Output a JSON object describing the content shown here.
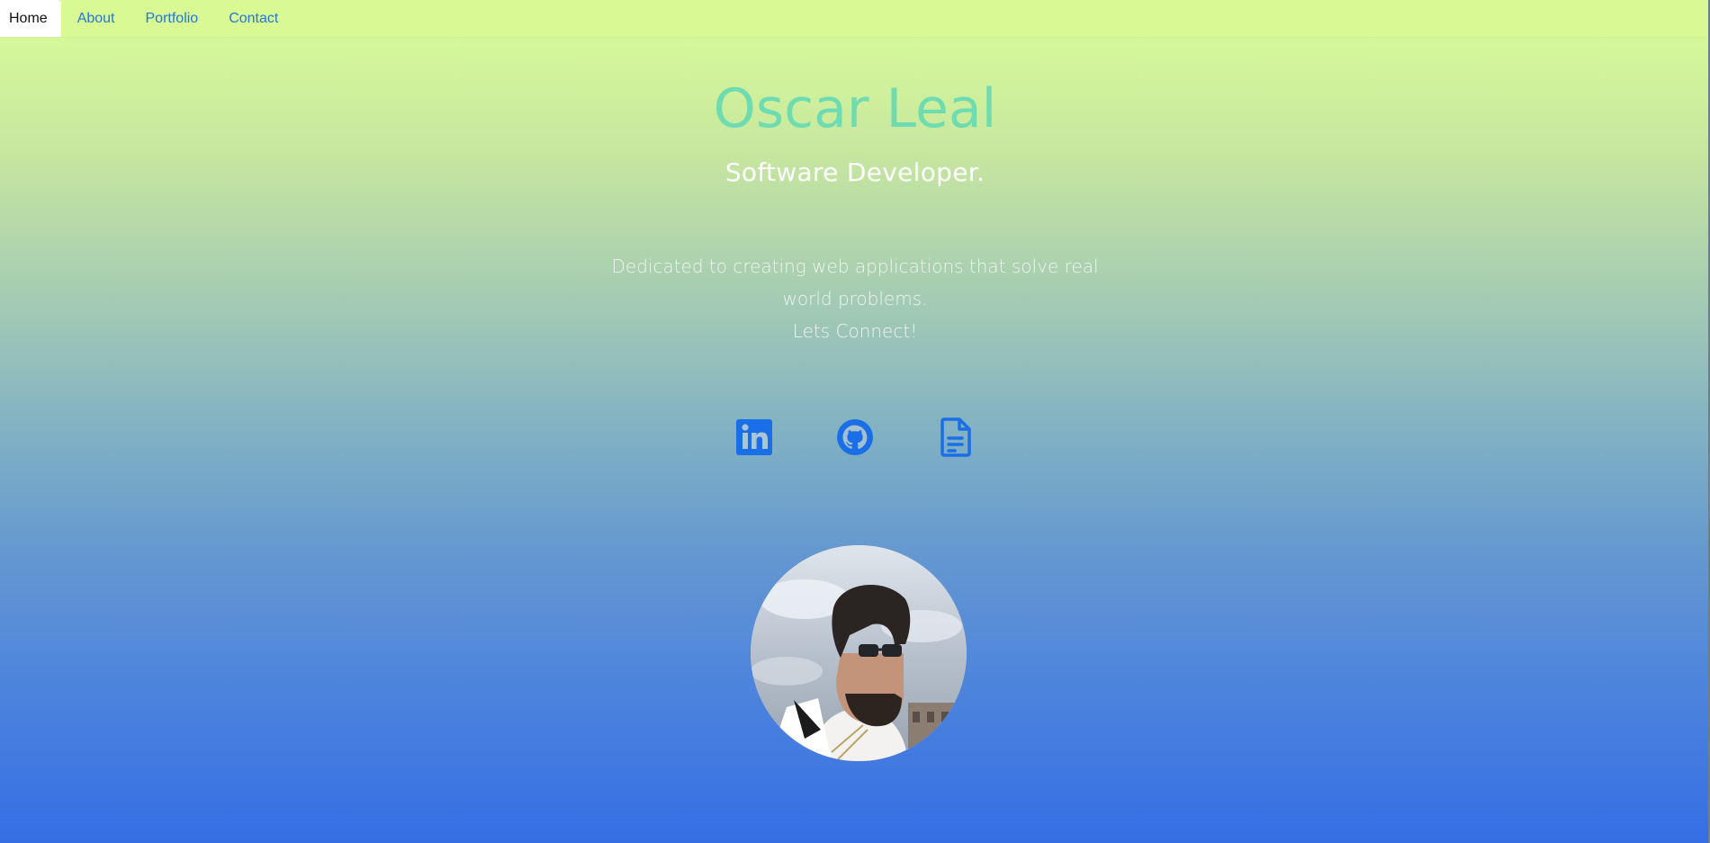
{
  "nav": {
    "items": [
      {
        "label": "Home",
        "active": true
      },
      {
        "label": "About",
        "active": false
      },
      {
        "label": "Portfolio",
        "active": false
      },
      {
        "label": "Contact",
        "active": false
      }
    ]
  },
  "hero": {
    "name": "Oscar Leal",
    "role": "Software Developer.",
    "tagline_line1": "Dedicated to creating web applications that solve real",
    "tagline_line2": "world problems.",
    "tagline_line3": "Lets Connect!"
  },
  "socials": [
    {
      "icon": "linkedin-icon"
    },
    {
      "icon": "github-icon"
    },
    {
      "icon": "resume-document-icon"
    }
  ],
  "colors": {
    "accent_blue": "#1a6fe8",
    "name_teal": "#6edcb0",
    "nav_link": "#2277d8",
    "gradient_top": "#dbfd97",
    "gradient_bottom": "#356ee4"
  },
  "avatar": {
    "alt": "profile photo"
  }
}
